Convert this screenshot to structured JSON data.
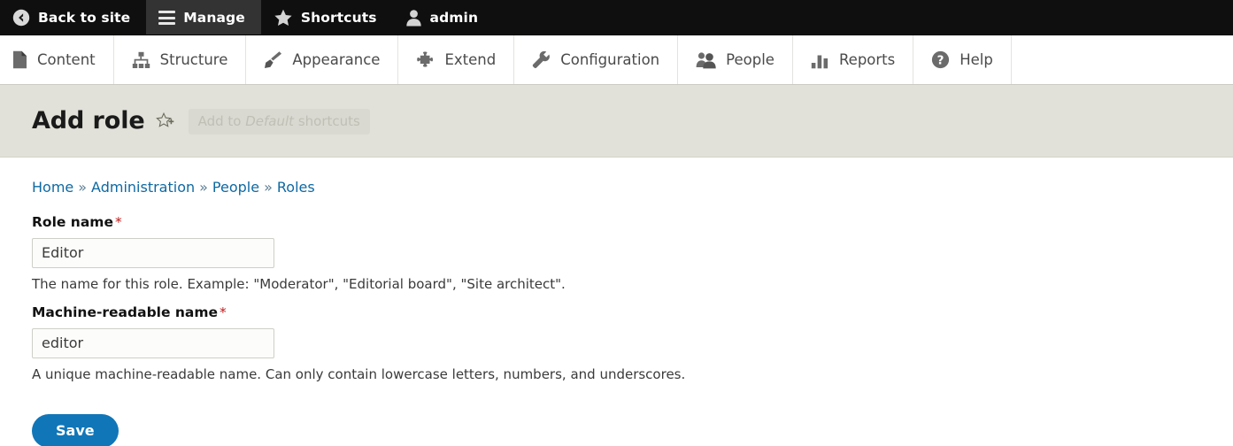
{
  "admin_toolbar": {
    "items": [
      {
        "label": "Back to site",
        "icon": "back-arrow-circle-icon",
        "active": false
      },
      {
        "label": "Manage",
        "icon": "hamburger-icon",
        "active": true
      },
      {
        "label": "Shortcuts",
        "icon": "star-icon",
        "active": false
      },
      {
        "label": "admin",
        "icon": "user-icon",
        "active": false
      }
    ],
    "background": "#0f0f0f",
    "active_background": "#333333"
  },
  "menu_bar": {
    "items": [
      {
        "label": "Content",
        "icon": "document-icon"
      },
      {
        "label": "Structure",
        "icon": "sitemap-icon"
      },
      {
        "label": "Appearance",
        "icon": "paintbrush-icon"
      },
      {
        "label": "Extend",
        "icon": "puzzle-piece-icon"
      },
      {
        "label": "Configuration",
        "icon": "wrench-icon"
      },
      {
        "label": "People",
        "icon": "people-icon"
      },
      {
        "label": "Reports",
        "icon": "bar-chart-icon"
      },
      {
        "label": "Help",
        "icon": "question-mark-circle-icon"
      }
    ]
  },
  "title_band": {
    "title": "Add role",
    "star_icon": "add-shortcut-star-icon",
    "tooltip_prefix": "Add to ",
    "tooltip_emphasis": "Default",
    "tooltip_suffix": " shortcuts",
    "background": "#e1e1d9"
  },
  "breadcrumb": {
    "separator": "»",
    "items": [
      {
        "label": "Home"
      },
      {
        "label": "Administration"
      },
      {
        "label": "People"
      },
      {
        "label": "Roles"
      }
    ]
  },
  "form": {
    "fields": [
      {
        "label": "Role name",
        "required_marker": "*",
        "value": "Editor",
        "placeholder": "",
        "description": "The name for this role. Example: \"Moderator\", \"Editorial board\", \"Site architect\"."
      },
      {
        "label": "Machine-readable name",
        "required_marker": "*",
        "value": "editor",
        "placeholder": "",
        "description": "A unique machine-readable name. Can only contain lowercase letters, numbers, and underscores."
      }
    ],
    "save_label": "Save",
    "save_color": "#1076b8"
  }
}
